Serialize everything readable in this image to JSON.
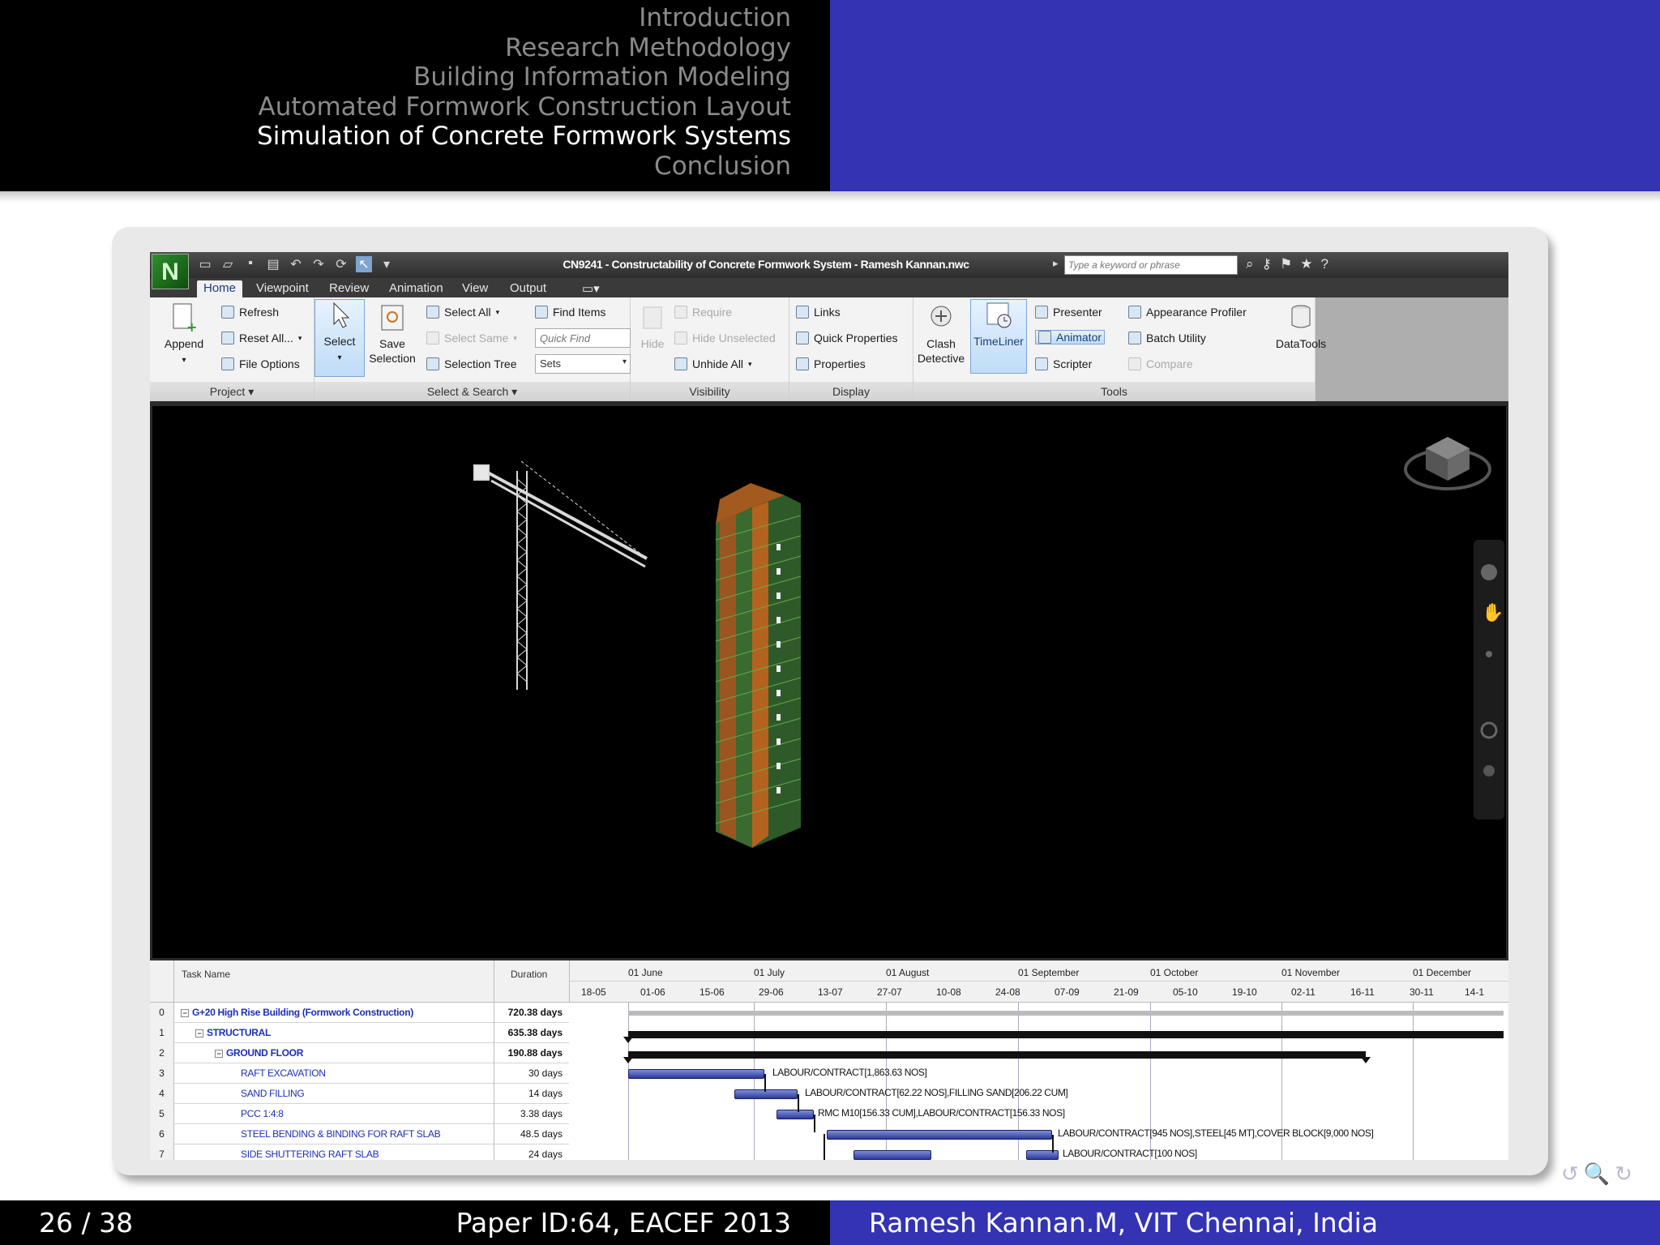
{
  "slide": {
    "nav_items": [
      "Introduction",
      "Research Methodology",
      "Building Information Modeling",
      "Automated Formwork Construction Layout",
      "Simulation of Concrete Formwork Systems",
      "Conclusion"
    ],
    "active_nav_index": 4,
    "page": "26 / 38",
    "paper_id": "Paper ID:64, EACEF 2013",
    "author": "Ramesh Kannan.M, VIT Chennai, India",
    "beamer_controls": "↺🔍↻",
    "colors": {
      "header_blue": "#3333b3",
      "header_black": "#000000",
      "nav_inactive": "#8a8a8a"
    }
  },
  "app": {
    "logo": "N",
    "title": "CN9241 - Constructability of Concrete Formwork System - Ramesh Kannan.nwc",
    "search_placeholder": "Type a keyword or phrase",
    "tabs": [
      "Home",
      "Viewpoint",
      "Review",
      "Animation",
      "View",
      "Output"
    ],
    "ribbon": {
      "project": {
        "label": "Project ▾",
        "append": "Append",
        "refresh": "Refresh",
        "reset_all": "Reset All...",
        "file_options": "File Options"
      },
      "select_search": {
        "label": "Select & Search ▾",
        "select": "Select",
        "save_selection": "Save Selection",
        "select_all": "Select All",
        "select_same": "Select Same",
        "selection_tree": "Selection Tree",
        "find_items": "Find Items",
        "quick_find": "Quick Find",
        "sets": "Sets"
      },
      "visibility": {
        "label": "Visibility",
        "hide": "Hide",
        "require": "Require",
        "hide_unselected": "Hide Unselected",
        "unhide_all": "Unhide All"
      },
      "display": {
        "label": "Display",
        "links": "Links",
        "quick_properties": "Quick Properties",
        "properties": "Properties"
      },
      "tools": {
        "label": "Tools",
        "clash_detective": "Clash Detective",
        "timeliner": "TimeLiner",
        "presenter": "Presenter",
        "animator": "Animator",
        "scripter": "Scripter",
        "appearance_profiler": "Appearance Profiler",
        "batch_utility": "Batch Utility",
        "compare": "Compare"
      },
      "datatools": "DataTools"
    },
    "gantt": {
      "headers": {
        "task_name": "Task Name",
        "duration": "Duration"
      },
      "months": [
        "01 June",
        "01 July",
        "01 August",
        "01 September",
        "01 October",
        "01 November",
        "01 December"
      ],
      "weeks": [
        "18-05",
        "01-06",
        "15-06",
        "29-06",
        "13-07",
        "27-07",
        "10-08",
        "24-08",
        "07-09",
        "21-09",
        "05-10",
        "19-10",
        "02-11",
        "16-11",
        "30-11",
        "14-1"
      ],
      "rows": [
        {
          "id": "0",
          "name": "G+20 High Rise Building (Formwork Construction)",
          "duration": "720.38 days",
          "level": 0,
          "summary": true
        },
        {
          "id": "1",
          "name": "STRUCTURAL",
          "duration": "635.38 days",
          "level": 1,
          "summary": true
        },
        {
          "id": "2",
          "name": "GROUND FLOOR",
          "duration": "190.88 days",
          "level": 2,
          "summary": true
        },
        {
          "id": "3",
          "name": "RAFT EXCAVATION",
          "duration": "30 days",
          "level": 3,
          "summary": false
        },
        {
          "id": "4",
          "name": "SAND FILLING",
          "duration": "14 days",
          "level": 3,
          "summary": false
        },
        {
          "id": "5",
          "name": "PCC 1:4:8",
          "duration": "3.38 days",
          "level": 3,
          "summary": false
        },
        {
          "id": "6",
          "name": "STEEL BENDING & BINDING FOR RAFT SLAB",
          "duration": "48.5 days",
          "level": 3,
          "summary": false
        },
        {
          "id": "7",
          "name": "SIDE SHUTTERING RAFT SLAB",
          "duration": "24 days",
          "level": 3,
          "summary": false
        }
      ],
      "bar_labels": [
        "LABOUR/CONTRACT[1,863.63 NOS]",
        "LABOUR/CONTRACT[62.22 NOS],FILLING SAND[206.22 CUM]",
        "RMC M10[156.33 CUM],LABOUR/CONTRACT[156.33 NOS]",
        "LABOUR/CONTRACT[945 NOS],STEEL[45 MT],COVER BLOCK[9,000 NOS]",
        "LABOUR/CONTRACT[100 NOS]"
      ]
    }
  }
}
